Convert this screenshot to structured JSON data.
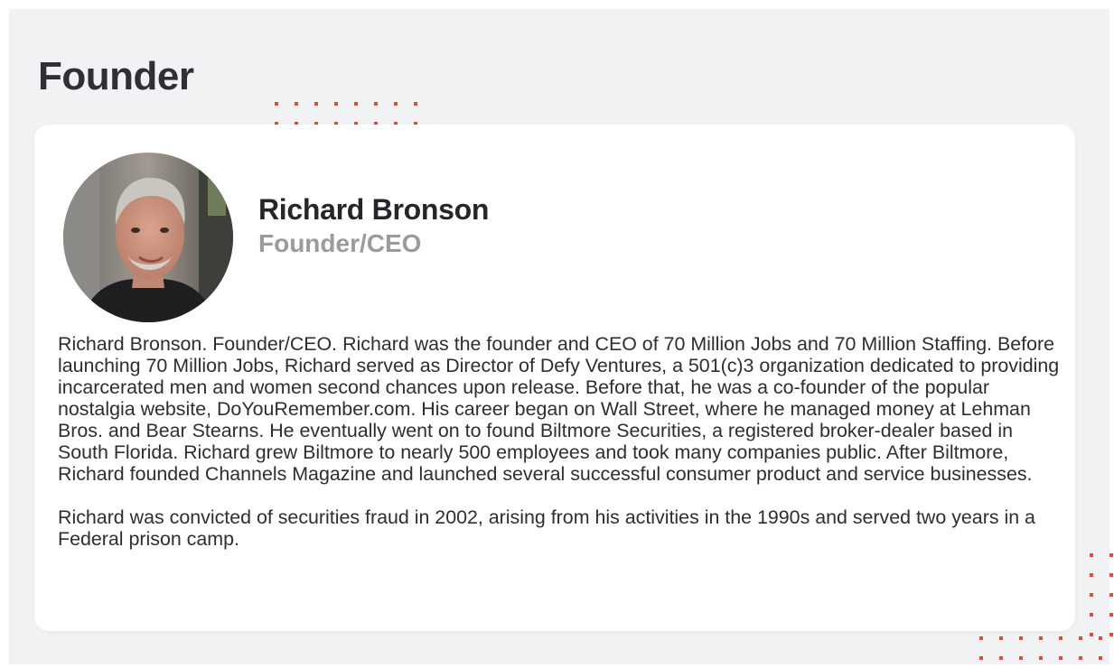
{
  "section": {
    "heading": "Founder"
  },
  "profile": {
    "name": "Richard Bronson",
    "role": "Founder/CEO",
    "avatar_icon": "person-portrait-photo"
  },
  "bio": {
    "paragraphs": [
      "Richard Bronson. Founder/CEO.  Richard was the founder and CEO of 70 Million Jobs and 70 Million Staffing. Before launching 70 Million Jobs, Richard served as Director of Defy Ventures, a 501(c)3 organization dedicated to providing incarcerated men and women second chances upon release. Before that, he was a co-founder of the popular nostalgia website, DoYouRemember.com. His career began on Wall Street, where he managed money at Lehman Bros. and Bear Stearns. He eventually went on to found Biltmore Securities, a registered broker-dealer based in South Florida. Richard grew Biltmore to nearly 500 employees and took many companies public. After Biltmore, Richard founded Channels Magazine and launched several successful consumer product and service businesses.",
      "Richard was convicted of securities fraud in 2002, arising from his activities in the 1990s and served two years in a Federal prison camp."
    ]
  },
  "colors": {
    "accent": "#e4493a",
    "background": "#f1f2f4",
    "card": "#ffffff",
    "heading": "#2f3033",
    "role": "#9b9b9b"
  }
}
